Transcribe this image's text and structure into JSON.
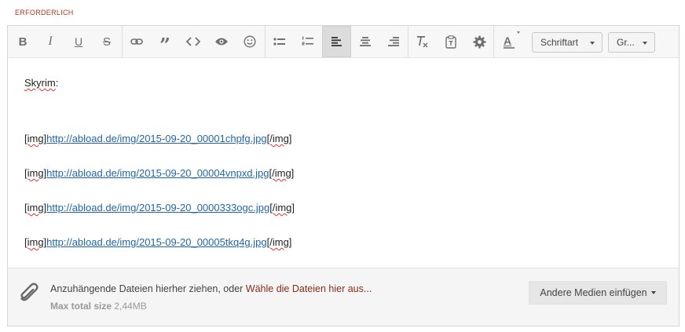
{
  "required_label": "ERFORDERLICH",
  "toolbar": {
    "buttons": [
      {
        "name": "bold-button",
        "icon": "bold-icon",
        "glyph": "B"
      },
      {
        "name": "italic-button",
        "icon": "italic-icon",
        "glyph": "I"
      },
      {
        "name": "underline-button",
        "icon": "underline-icon",
        "glyph": "U"
      },
      {
        "name": "strikethrough-button",
        "icon": "strikethrough-icon",
        "glyph": "S"
      },
      {
        "name": "link-button",
        "icon": "link-icon"
      },
      {
        "name": "quote-button",
        "icon": "quote-icon",
        "glyph": "”"
      },
      {
        "name": "code-button",
        "icon": "code-icon",
        "glyph": "<>"
      },
      {
        "name": "preview-button",
        "icon": "eye-icon"
      },
      {
        "name": "emoji-button",
        "icon": "smiley-icon"
      },
      {
        "name": "bullet-list-button",
        "icon": "bullet-list-icon"
      },
      {
        "name": "numbered-list-button",
        "icon": "numbered-list-icon"
      },
      {
        "name": "align-left-button",
        "icon": "align-left-icon",
        "active": true
      },
      {
        "name": "align-center-button",
        "icon": "align-center-icon"
      },
      {
        "name": "align-right-button",
        "icon": "align-right-icon"
      },
      {
        "name": "remove-format-button",
        "icon": "clear-format-icon"
      },
      {
        "name": "paste-text-button",
        "icon": "clipboard-icon"
      },
      {
        "name": "settings-button",
        "icon": "gear-icon"
      },
      {
        "name": "text-color-button",
        "icon": "text-color-icon",
        "glyph": "A"
      }
    ],
    "font_dropdown": "Schriftart",
    "size_dropdown": "Gr..."
  },
  "content": {
    "heading": "Skyrim",
    "heading_suffix": ":",
    "lines": [
      {
        "open": "[img]",
        "url": "http://abload.de/img/2015-09-20_00001chpfg.jpg",
        "close": "[/img]"
      },
      {
        "open": "[img]",
        "url": "http://abload.de/img/2015-09-20_00004vnpxd.jpg",
        "close": "[/img]"
      },
      {
        "open": "[img]",
        "url": "http://abload.de/img/2015-09-20_0000333ogc.jpg",
        "close": "[/img]"
      },
      {
        "open": "[img]",
        "url": "http://abload.de/img/2015-09-20_00005tkq4g.jpg",
        "close": "[/img]"
      }
    ]
  },
  "footer": {
    "attach_text": "Anzuhängende Dateien hierher ziehen, oder ",
    "attach_link": "Wähle die Dateien hier aus...",
    "max_label": "Max total size",
    "max_value": "2,44MB",
    "media_button": "Andere Medien einfügen"
  },
  "colors": {
    "required": "#b0361e",
    "link": "#2266aa",
    "pick_link": "#8a2a18"
  }
}
